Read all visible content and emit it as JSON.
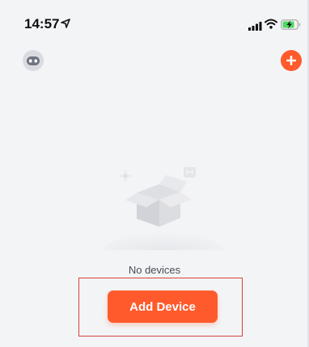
{
  "status_bar": {
    "time": "14:57"
  },
  "header": {
    "avatar_icon": "robot-avatar-icon",
    "add_icon": "plus-circle-icon"
  },
  "empty_state": {
    "illustration": "open-box-icon",
    "message": "No devices"
  },
  "actions": {
    "add_device_label": "Add Device"
  },
  "colors": {
    "accent": "#ff5a2c",
    "background": "#f3f4f6",
    "highlight": "#d6433a"
  }
}
